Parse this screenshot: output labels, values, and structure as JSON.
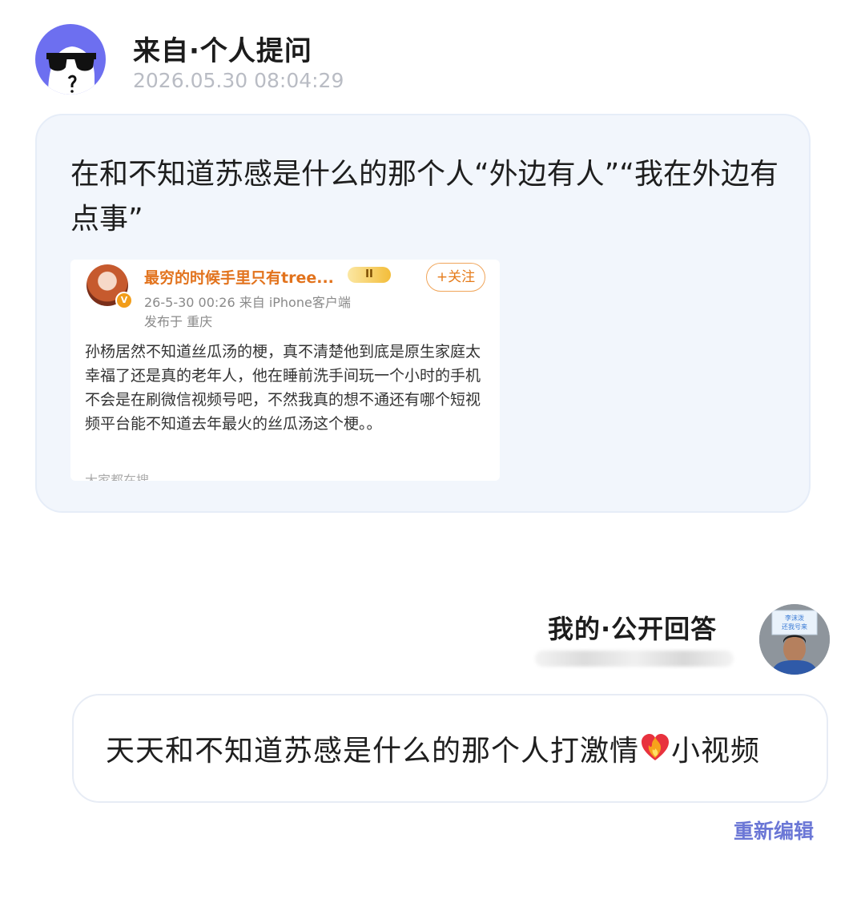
{
  "question": {
    "source_label": "来自·个人提问",
    "timestamp": "2026.05.30 08:04:29",
    "text": "在和不知道苏感是什么的那个人“外边有人”“我在外边有点事”",
    "embedded_post": {
      "author": "最穷的时候手里只有tree...",
      "vip_badge": "II",
      "follow_label": "+关注",
      "meta": "26-5-30 00:26  来自 iPhone客户端",
      "location": "发布于 重庆",
      "body": "孙杨居然不知道丝瓜汤的梗，真不清楚他到底是原生家庭太幸福了还是真的老年人，他在睡前洗手间玩一个小时的手机不会是在刷微信视频号吧，不然我真的想不通还有哪个短视频平台能不知道去年最火的丝瓜汤这个梗。。",
      "cut_text": "大家都在搜",
      "verified_badge": "V"
    }
  },
  "answer": {
    "label": "我的·公开回答",
    "text_before": "天天和不知道苏感是什么的那个人打激情",
    "emoji": "heart-on-fire",
    "text_after": "小视频",
    "edit_label": "重新编辑",
    "avatar_sign_text": "李沫泼 还我号来"
  },
  "colors": {
    "accent": "#6b77d6",
    "question_avatar": "#6d6ff0",
    "card_bg": "#f2f6fc",
    "weibo_name": "#e2731d"
  }
}
